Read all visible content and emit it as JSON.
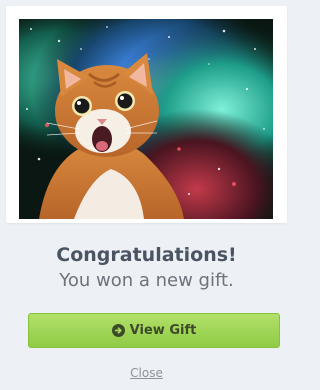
{
  "hero": {
    "image_alt": "surprised orange cat in front of a space nebula"
  },
  "message": {
    "title": "Congratulations!",
    "subtitle": "You won a new gift."
  },
  "actions": {
    "primary_label": "View Gift",
    "primary_icon": "arrow-circle-right-icon",
    "close_label": "Close"
  },
  "colors": {
    "background": "#edf0f4",
    "button_green": "#9ed456",
    "title_text": "#4a5462",
    "subtitle_text": "#6c737d",
    "close_text": "#8d939b"
  }
}
